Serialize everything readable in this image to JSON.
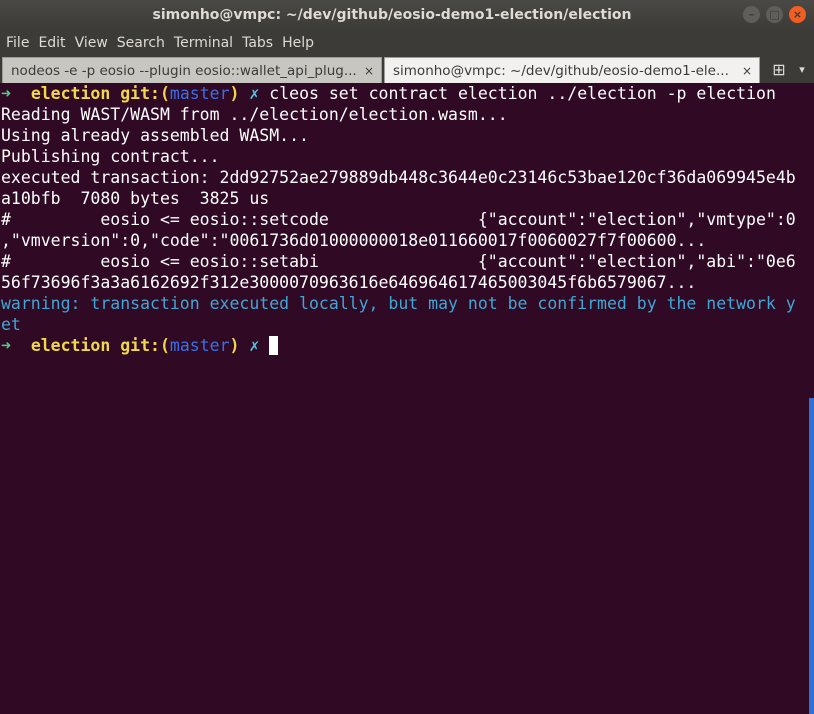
{
  "window": {
    "title": "simonho@vmpc: ~/dev/github/eosio-demo1-election/election",
    "controls": {
      "minimize": "–",
      "maximize": "□",
      "close": "×"
    }
  },
  "menu": {
    "items": [
      "File",
      "Edit",
      "View",
      "Search",
      "Terminal",
      "Tabs",
      "Help"
    ]
  },
  "tabs": [
    {
      "label": "nodeos -e -p eosio --plugin eosio::wallet_api_plug...",
      "active": false,
      "close": "×"
    },
    {
      "label": "simonho@vmpc: ~/dev/github/eosio-demo1-ele...",
      "active": true,
      "close": "×"
    }
  ],
  "tab_actions": {
    "add": "⊞",
    "menu": "▾"
  },
  "terminal": {
    "prompt": {
      "arrow": "➜",
      "dir": "election",
      "git_prefix": "git:(",
      "branch": "master",
      "git_suffix": ")",
      "status": "✗"
    },
    "command": "cleos set contract election ../election -p election",
    "output": [
      "Reading WAST/WASM from ../election/election.wasm...",
      "Using already assembled WASM...",
      "Publishing contract...",
      "executed transaction: 2dd92752ae279889db448c3644e0c23146c53bae120cf36da069945e4b",
      "a10bfb  7080 bytes  3825 us",
      "#         eosio <= eosio::setcode               {\"account\":\"election\",\"vmtype\":0",
      ",\"vmversion\":0,\"code\":\"0061736d01000000018e011660017f0060027f7f00600...",
      "#         eosio <= eosio::setabi                {\"account\":\"election\",\"abi\":\"0e6",
      "56f73696f3a3a6162692f312e3000070963616e646964617465003045f6b6579067..."
    ],
    "warning": [
      "warning: transaction executed locally, but may not be confirmed by the network y",
      "et"
    ]
  }
}
